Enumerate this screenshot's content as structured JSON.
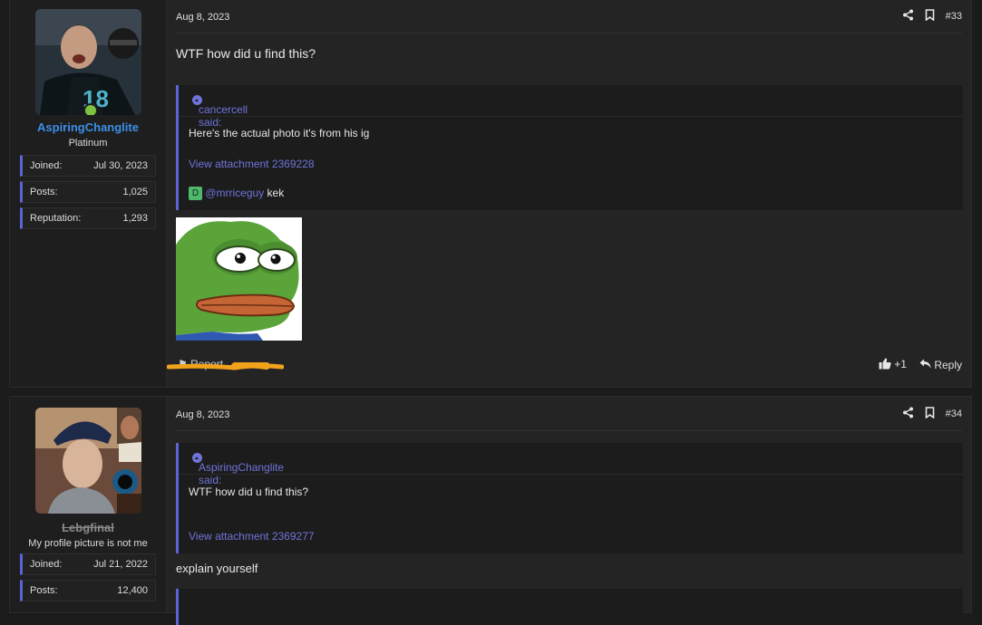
{
  "post1": {
    "user": {
      "name": "AspiringChanglite",
      "name_color": "#3b8fe8",
      "title": "Platinum",
      "stats": [
        {
          "label": "Joined:",
          "value": "Jul 30, 2023"
        },
        {
          "label": "Posts:",
          "value": "1,025"
        },
        {
          "label": "Reputation:",
          "value": "1,293"
        }
      ],
      "online": true
    },
    "date": "Aug 8, 2023",
    "number": "#33",
    "message": "WTF how did u find this?",
    "quote": {
      "header": "cancercell said:",
      "text": "Here's the actual photo it's from his ig",
      "link": "View attachment 2369228",
      "mention_badge": "D",
      "mention": "@mrriceguy",
      "mention_after": "kek"
    },
    "footer": {
      "report": "Report",
      "like": "+1",
      "reply": "Reply"
    }
  },
  "post2": {
    "user": {
      "name": "Lebgfinal",
      "title": "My profile picture is not me",
      "stats": [
        {
          "label": "Joined:",
          "value": "Jul 21, 2022"
        },
        {
          "label": "Posts:",
          "value": "12,400"
        }
      ]
    },
    "date": "Aug 8, 2023",
    "number": "#34",
    "quote": {
      "header": "AspiringChanglite said:",
      "text": "WTF how did u find this?",
      "link": "View attachment 2369277"
    },
    "message": "explain yourself"
  },
  "colors": {
    "accent": "#5c63d6",
    "link": "#6f74d9",
    "online": "#7fc241"
  }
}
